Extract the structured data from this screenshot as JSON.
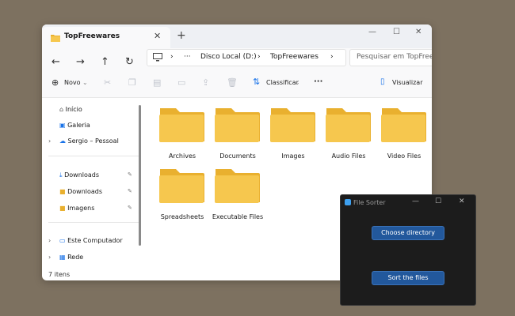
{
  "explorer": {
    "tab_title": "TopFreewares",
    "tab_close": "✕",
    "new_tab": "+",
    "breadcrumb": {
      "more": "···",
      "segments": [
        "Disco Local (D:)",
        "TopFreewares"
      ]
    },
    "search_placeholder": "Pesquisar em TopFreewa",
    "toolbar": {
      "new_label": "Novo",
      "sort_label": "Classificar",
      "more_label": "···",
      "view_label": "Visualizar"
    },
    "sidebar": {
      "items": [
        {
          "label": "Início",
          "icon": "home-icon"
        },
        {
          "label": "Galeria",
          "icon": "gallery-icon"
        },
        {
          "label": "Sergio – Pessoal",
          "icon": "onedrive-icon"
        },
        {
          "label": "Downloads",
          "icon": "download-icon"
        },
        {
          "label": "Downloads",
          "icon": "folder-icon"
        },
        {
          "label": "Imagens",
          "icon": "folder-icon"
        },
        {
          "label": "Este Computador",
          "icon": "computer-icon"
        },
        {
          "label": "Rede",
          "icon": "network-icon"
        }
      ]
    },
    "folders": [
      "Archives",
      "Documents",
      "Images",
      "Audio Files",
      "Video Files",
      "Spreadsheets",
      "Executable Files"
    ],
    "status": "7 itens",
    "colors": {
      "folder": "#f6c74e",
      "folder_back": "#e9b02f",
      "accent": "#1a73e8"
    }
  },
  "file_sorter": {
    "title": "File Sorter",
    "choose_label": "Choose directory",
    "sort_label": "Sort the files",
    "colors": {
      "background": "#1c1c1c",
      "button": "#22589c"
    }
  }
}
